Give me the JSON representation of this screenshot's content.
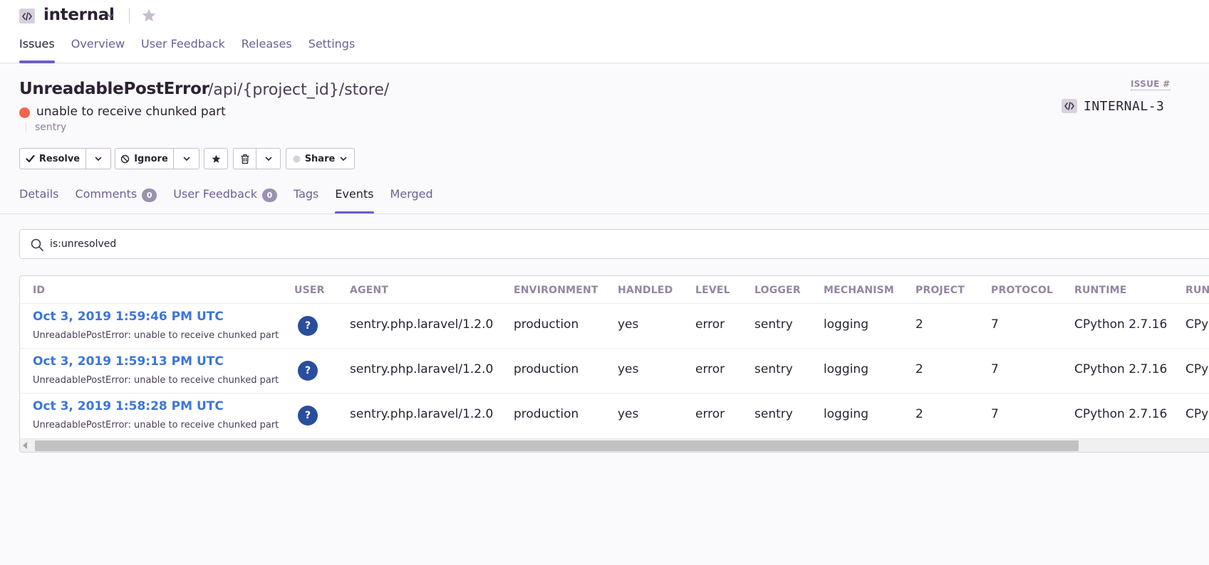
{
  "project": {
    "name": "internal",
    "icon": "code-icon",
    "star_icon": "star-icon"
  },
  "top_nav": {
    "tabs": [
      {
        "label": "Issues",
        "active": true
      },
      {
        "label": "Overview",
        "active": false
      },
      {
        "label": "User Feedback",
        "active": false
      },
      {
        "label": "Releases",
        "active": false
      },
      {
        "label": "Settings",
        "active": false
      }
    ]
  },
  "issue": {
    "title": "UnreadablePostError",
    "culprit": "/api/{project_id}/store/",
    "message": "unable to receive chunked part",
    "logger": "sentry",
    "level_color": "#F2654B",
    "issue_label": "ISSUE #",
    "short_id": "INTERNAL-3"
  },
  "actions": {
    "resolve": "Resolve",
    "ignore": "Ignore",
    "share": "Share"
  },
  "sub_nav": {
    "tabs": [
      {
        "label": "Details",
        "active": false
      },
      {
        "label": "Comments",
        "badge": "0",
        "active": false
      },
      {
        "label": "User Feedback",
        "badge": "0",
        "active": false
      },
      {
        "label": "Tags",
        "active": false
      },
      {
        "label": "Events",
        "active": true
      },
      {
        "label": "Merged",
        "active": false
      }
    ]
  },
  "search": {
    "value": "is:unresolved"
  },
  "events_table": {
    "headers": [
      "ID",
      "USER",
      "AGENT",
      "ENVIRONMENT",
      "HANDLED",
      "LEVEL",
      "LOGGER",
      "MECHANISM",
      "PROJECT",
      "PROTOCOL",
      "RUNTIME",
      "RUN"
    ],
    "rows": [
      {
        "date": "Oct 3, 2019 1:59:46 PM UTC",
        "sub": "UnreadablePostError: unable to receive chunked part",
        "user": "?",
        "agent": "sentry.php.laravel/1.2.0",
        "environment": "production",
        "handled": "yes",
        "level": "error",
        "logger": "sentry",
        "mechanism": "logging",
        "project": "2",
        "protocol": "7",
        "runtime": "CPython 2.7.16",
        "run": "CPy"
      },
      {
        "date": "Oct 3, 2019 1:59:13 PM UTC",
        "sub": "UnreadablePostError: unable to receive chunked part",
        "user": "?",
        "agent": "sentry.php.laravel/1.2.0",
        "environment": "production",
        "handled": "yes",
        "level": "error",
        "logger": "sentry",
        "mechanism": "logging",
        "project": "2",
        "protocol": "7",
        "runtime": "CPython 2.7.16",
        "run": "CPy"
      },
      {
        "date": "Oct 3, 2019 1:58:28 PM UTC",
        "sub": "UnreadablePostError: unable to receive chunked part",
        "user": "?",
        "agent": "sentry.php.laravel/1.2.0",
        "environment": "production",
        "handled": "yes",
        "level": "error",
        "logger": "sentry",
        "mechanism": "logging",
        "project": "2",
        "protocol": "7",
        "runtime": "CPython 2.7.16",
        "run": "CPy"
      }
    ]
  },
  "colors": {
    "accent": "#6C5FC7",
    "link": "#3D74DB",
    "avatar": "#2A4E9E"
  }
}
